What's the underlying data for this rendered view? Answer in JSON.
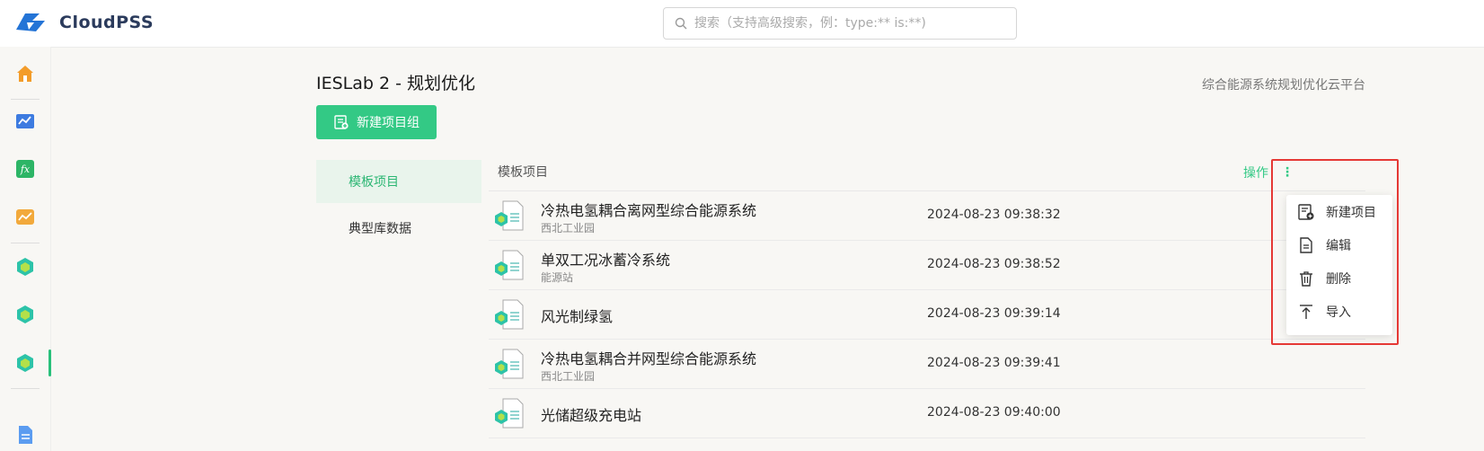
{
  "brand": {
    "name": "CloudPSS"
  },
  "search": {
    "placeholder": "搜索（支持高级搜索，例：type:** is:**)"
  },
  "page": {
    "title": "IESLab 2 - 规划优化",
    "subtitle": "综合能源系统规划优化云平台",
    "new_group_label": "新建项目组"
  },
  "tabs": [
    {
      "label": "模板项目",
      "active": true
    },
    {
      "label": "典型库数据",
      "active": false
    }
  ],
  "list": {
    "header": "模板项目",
    "ops_label": "操作",
    "ops_more": "⋮",
    "rows": [
      {
        "name": "冷热电氢耦合离网型综合能源系统",
        "desc": "西北工业园",
        "date": "2024-08-23 09:38:32"
      },
      {
        "name": "单双工况冰蓄冷系统",
        "desc": "能源站",
        "date": "2024-08-23 09:38:52"
      },
      {
        "name": "风光制绿氢",
        "desc": "",
        "date": "2024-08-23 09:39:14"
      },
      {
        "name": "冷热电氢耦合并网型综合能源系统",
        "desc": "西北工业园",
        "date": "2024-08-23 09:39:41"
      },
      {
        "name": "光储超级充电站",
        "desc": "",
        "date": "2024-08-23 09:40:00"
      }
    ]
  },
  "menu": [
    {
      "label": "新建项目",
      "icon": "new-project-icon"
    },
    {
      "label": "编辑",
      "icon": "edit-doc-icon"
    },
    {
      "label": "删除",
      "icon": "trash-icon"
    },
    {
      "label": "导入",
      "icon": "import-icon"
    }
  ],
  "colors": {
    "accent": "#33c985",
    "highlight": "#e53935",
    "brand": "#2b3b5c"
  }
}
